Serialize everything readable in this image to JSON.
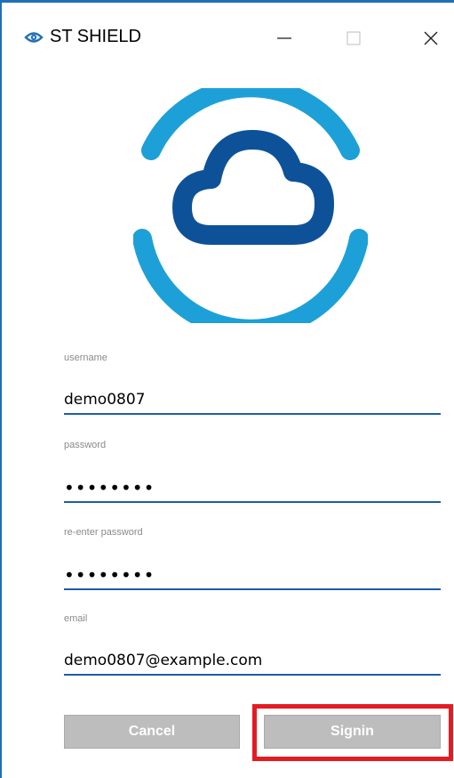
{
  "window": {
    "title": "ST SHIELD",
    "accent_color": "#1f6fb8",
    "icons": {
      "app": "shield-eye-icon",
      "minimize": "minimize-icon",
      "maximize": "maximize-icon",
      "close": "close-icon"
    }
  },
  "logo": {
    "icon": "cloud-icon",
    "ring_color": "#1da0d8",
    "cloud_color": "#0d5298"
  },
  "form": {
    "username": {
      "label": "username",
      "value": "demo0807"
    },
    "password": {
      "label": "password",
      "value": "••••••••"
    },
    "confirm_password": {
      "label": "re-enter password",
      "value": "••••••••"
    },
    "email": {
      "label": "email",
      "value": "demo0807@example.com"
    },
    "underline_color": "#1a5fa6"
  },
  "actions": {
    "cancel_label": "Cancel",
    "signin_label": "Signin",
    "highlight_color": "#e41b23"
  }
}
